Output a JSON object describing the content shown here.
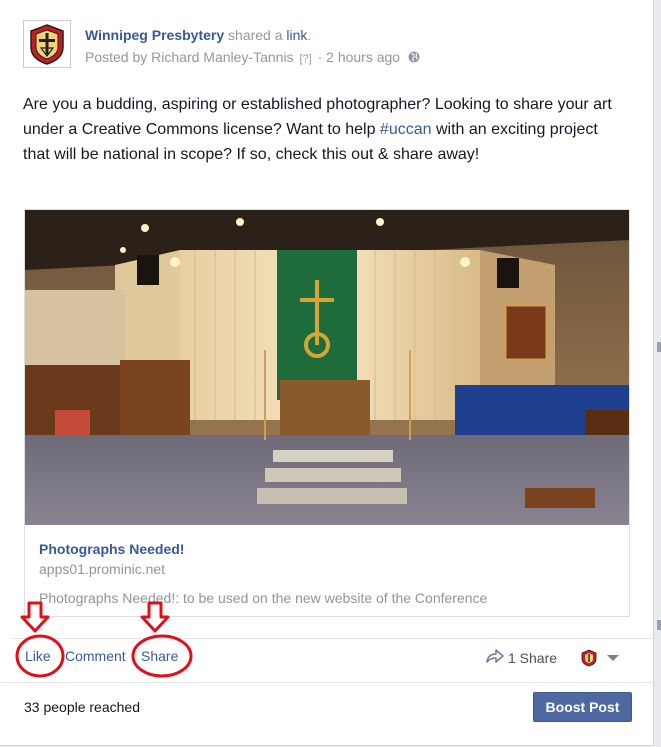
{
  "post": {
    "author": "Winnipeg Presbytery",
    "action_text": "shared a",
    "action_link": "link",
    "action_end": ".",
    "posted_by_prefix": "Posted by",
    "posted_by_name": "Richard Manley-Tannis",
    "help_marker": "[?]",
    "separator": "·",
    "time": "2 hours ago",
    "text_part1": "Are you a budding, aspiring or established photographer? Looking to share your art under a Creative Commons license? Want to help ",
    "hashtag": "#uccan",
    "text_part2": " with an exciting project that will be national in scope? If so, check this out & share away!"
  },
  "link_preview": {
    "title": "Photographs Needed!",
    "domain": "apps01.prominic.net",
    "description": "Photographs Needed!: to be used on the new website of the Conference"
  },
  "actions": {
    "like": "Like",
    "comment": "Comment",
    "share": "Share",
    "share_count": "1 Share"
  },
  "footer": {
    "reach": "33 people reached",
    "boost_label": "Boost Post"
  },
  "colors": {
    "link_blue": "#3b5998",
    "boost_blue": "#4e69a2",
    "annotation_red": "#e0101a"
  },
  "icons": [
    "page-logo-icon",
    "globe-icon",
    "share-arrow-icon",
    "page-avatar-icon",
    "caret-down-icon",
    "red-arrow-icon"
  ]
}
